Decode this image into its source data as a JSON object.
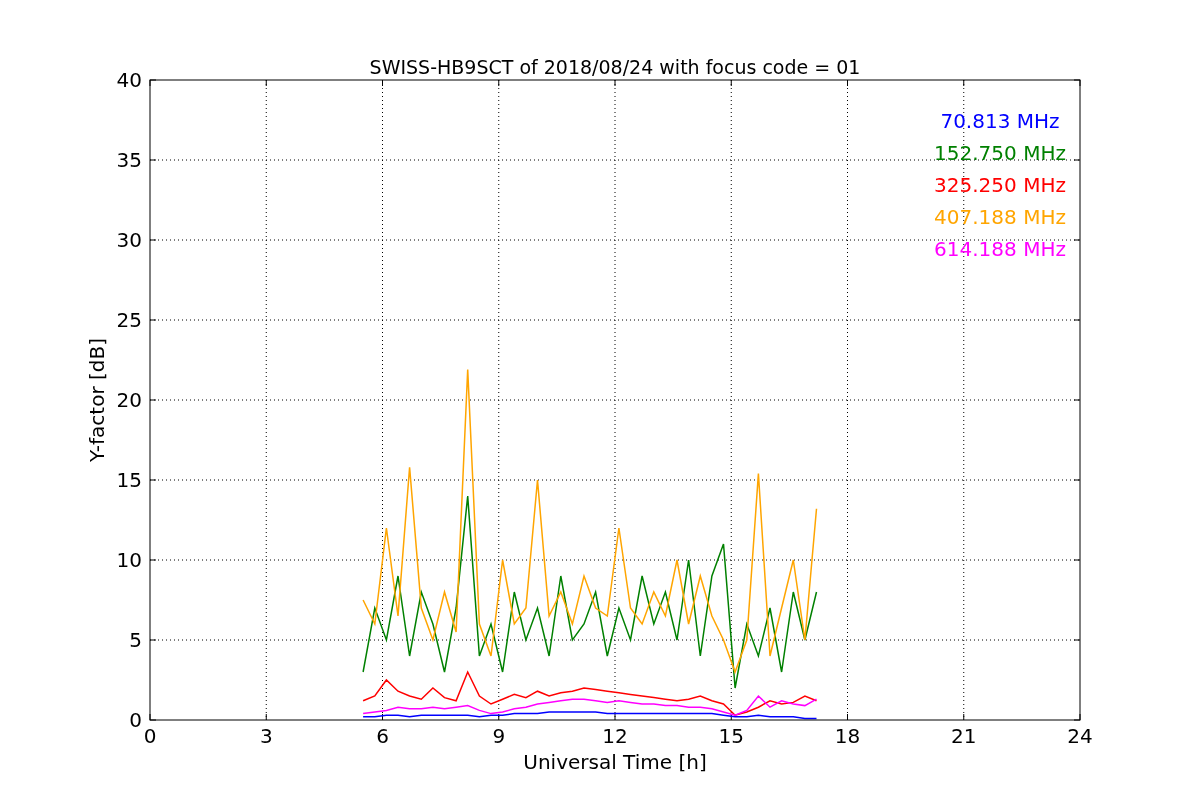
{
  "chart_data": {
    "type": "line",
    "grid": true,
    "title": "SWISS-HB9SCT of 2018/08/24 with focus code = 01",
    "xlabel": "Universal Time [h]",
    "ylabel": "Y-factor [dB]",
    "xlim": [
      0,
      24
    ],
    "ylim": [
      0,
      40
    ],
    "xticks": [
      0,
      3,
      6,
      9,
      12,
      15,
      18,
      21,
      24
    ],
    "yticks": [
      0,
      5,
      10,
      15,
      20,
      25,
      30,
      35,
      40
    ],
    "x": [
      5.5,
      5.8,
      6.1,
      6.4,
      6.7,
      7.0,
      7.3,
      7.6,
      7.9,
      8.2,
      8.5,
      8.8,
      9.1,
      9.4,
      9.7,
      10.0,
      10.3,
      10.6,
      10.9,
      11.2,
      11.5,
      11.8,
      12.1,
      12.4,
      12.7,
      13.0,
      13.3,
      13.6,
      13.9,
      14.2,
      14.5,
      14.8,
      15.1,
      15.4,
      15.7,
      16.0,
      16.3,
      16.6,
      16.9,
      17.2
    ],
    "series": [
      {
        "name": "70.813 MHz",
        "color": "#0000ff",
        "values": [
          0.2,
          0.2,
          0.3,
          0.3,
          0.2,
          0.3,
          0.3,
          0.3,
          0.3,
          0.3,
          0.2,
          0.3,
          0.3,
          0.4,
          0.4,
          0.4,
          0.5,
          0.5,
          0.5,
          0.5,
          0.5,
          0.4,
          0.4,
          0.4,
          0.4,
          0.4,
          0.4,
          0.4,
          0.4,
          0.4,
          0.4,
          0.3,
          0.2,
          0.2,
          0.3,
          0.2,
          0.2,
          0.2,
          0.1,
          0.1
        ]
      },
      {
        "name": "152.750 MHz",
        "color": "#008000",
        "values": [
          3,
          7,
          5,
          9,
          4,
          8,
          6,
          3,
          7,
          14,
          4,
          6,
          3,
          8,
          5,
          7,
          4,
          9,
          5,
          6,
          8,
          4,
          7,
          5,
          9,
          6,
          8,
          5,
          10,
          4,
          9,
          11,
          2,
          6,
          4,
          7,
          3,
          8,
          5,
          8
        ]
      },
      {
        "name": "325.250 MHz",
        "color": "#ff0000",
        "values": [
          1.2,
          1.5,
          2.5,
          1.8,
          1.5,
          1.3,
          2,
          1.4,
          1.2,
          3,
          1.5,
          1,
          1.3,
          1.6,
          1.4,
          1.8,
          1.5,
          1.7,
          1.8,
          2,
          1.9,
          1.8,
          1.7,
          1.6,
          1.5,
          1.4,
          1.3,
          1.2,
          1.3,
          1.5,
          1.2,
          1,
          0.3,
          0.5,
          0.8,
          1.2,
          1,
          1.1,
          1.5,
          1.2
        ]
      },
      {
        "name": "407.188 MHz",
        "color": "#ffa500",
        "values": [
          7.5,
          6,
          12,
          6.5,
          15.8,
          7,
          5,
          8,
          5.5,
          21.9,
          6,
          4,
          10,
          6,
          7,
          15,
          6.5,
          8,
          6,
          9,
          7,
          6.5,
          12,
          7,
          6,
          8,
          6.5,
          10,
          6,
          9,
          6.5,
          5,
          3,
          5,
          15.4,
          4,
          7,
          10,
          5,
          13.2
        ]
      },
      {
        "name": "614.188 MHz",
        "color": "#ff00ff",
        "values": [
          0.4,
          0.5,
          0.6,
          0.8,
          0.7,
          0.7,
          0.8,
          0.7,
          0.8,
          0.9,
          0.6,
          0.4,
          0.5,
          0.7,
          0.8,
          1,
          1.1,
          1.2,
          1.3,
          1.3,
          1.2,
          1.1,
          1.2,
          1.1,
          1,
          1,
          0.9,
          0.9,
          0.8,
          0.8,
          0.7,
          0.5,
          0.3,
          0.6,
          1.5,
          0.8,
          1.2,
          1,
          0.9,
          1.3
        ]
      }
    ]
  }
}
